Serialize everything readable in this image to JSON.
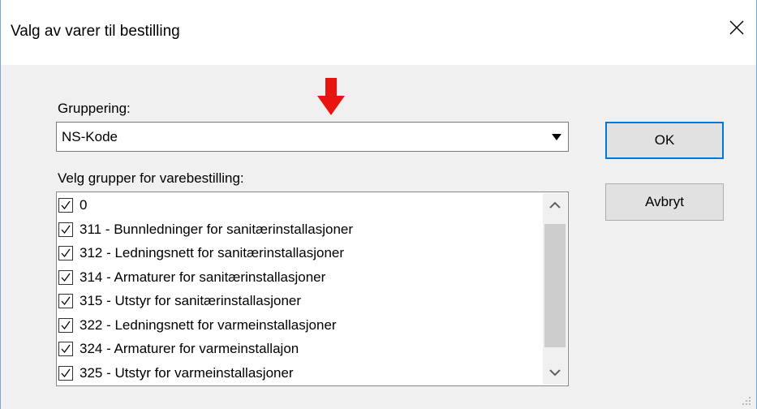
{
  "dialog": {
    "title": "Valg av varer til bestilling",
    "close_icon": "close-icon"
  },
  "grouping": {
    "label": "Gruppering:",
    "selected": "NS-Kode",
    "indicator_icon": "red-down-arrow-icon",
    "indicator_color": "#e8140f"
  },
  "groups": {
    "label": "Velg grupper for varebestilling:",
    "items": [
      {
        "text": "0",
        "checked": true
      },
      {
        "text": "311 - Bunnledninger for sanitærinstallasjoner",
        "checked": true
      },
      {
        "text": "312 - Ledningsnett for sanitærinstallasjoner",
        "checked": true
      },
      {
        "text": "314 - Armaturer for sanitærinstallasjoner",
        "checked": true
      },
      {
        "text": "315 - Utstyr for sanitærinstallasjoner",
        "checked": true
      },
      {
        "text": "322 - Ledningsnett for varmeinstallasjoner",
        "checked": true
      },
      {
        "text": "324 - Armaturer for varmeinstallajon",
        "checked": true
      },
      {
        "text": "325 - Utstyr for varmeinstallasjoner",
        "checked": true
      }
    ]
  },
  "buttons": {
    "ok": "OK",
    "cancel": "Avbryt"
  }
}
